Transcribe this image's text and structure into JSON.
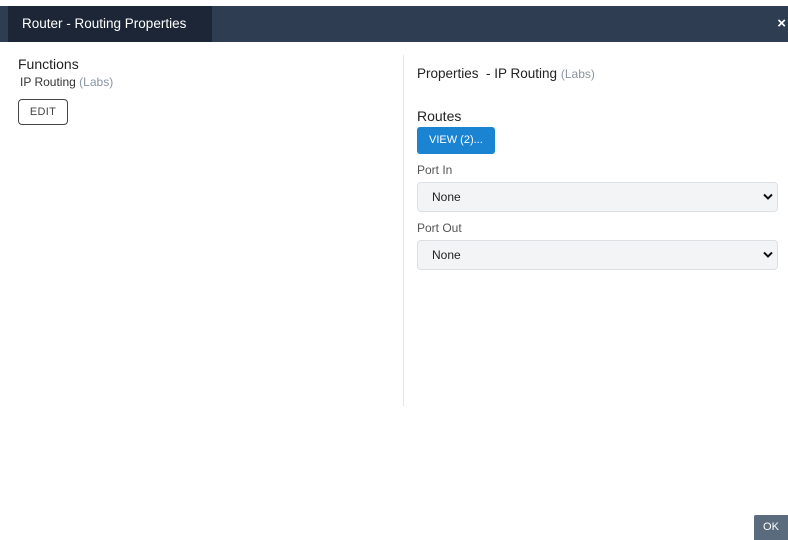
{
  "window": {
    "title": "Router - Routing Properties",
    "close_label": "×"
  },
  "functions": {
    "heading": "Functions",
    "item_name": "IP Routing",
    "item_tag": "(Labs)",
    "edit_label": "EDIT"
  },
  "properties": {
    "heading": "Properties  - IP Routing",
    "heading_tag": "(Labs)",
    "routes_label": "Routes",
    "view_button_label": "VIEW (2)...",
    "port_in_label": "Port In",
    "port_in_value": "None",
    "port_out_label": "Port Out",
    "port_out_value": "None"
  },
  "footer": {
    "ok_label": "OK"
  },
  "colors": {
    "titlebar": "#2e3d51",
    "title_tab": "#1c2636",
    "primary": "#1a84d3",
    "ok_button": "#5b6b7e"
  },
  "icons": {
    "close": "close-icon",
    "select_arrow": "chevron-down-icon"
  }
}
